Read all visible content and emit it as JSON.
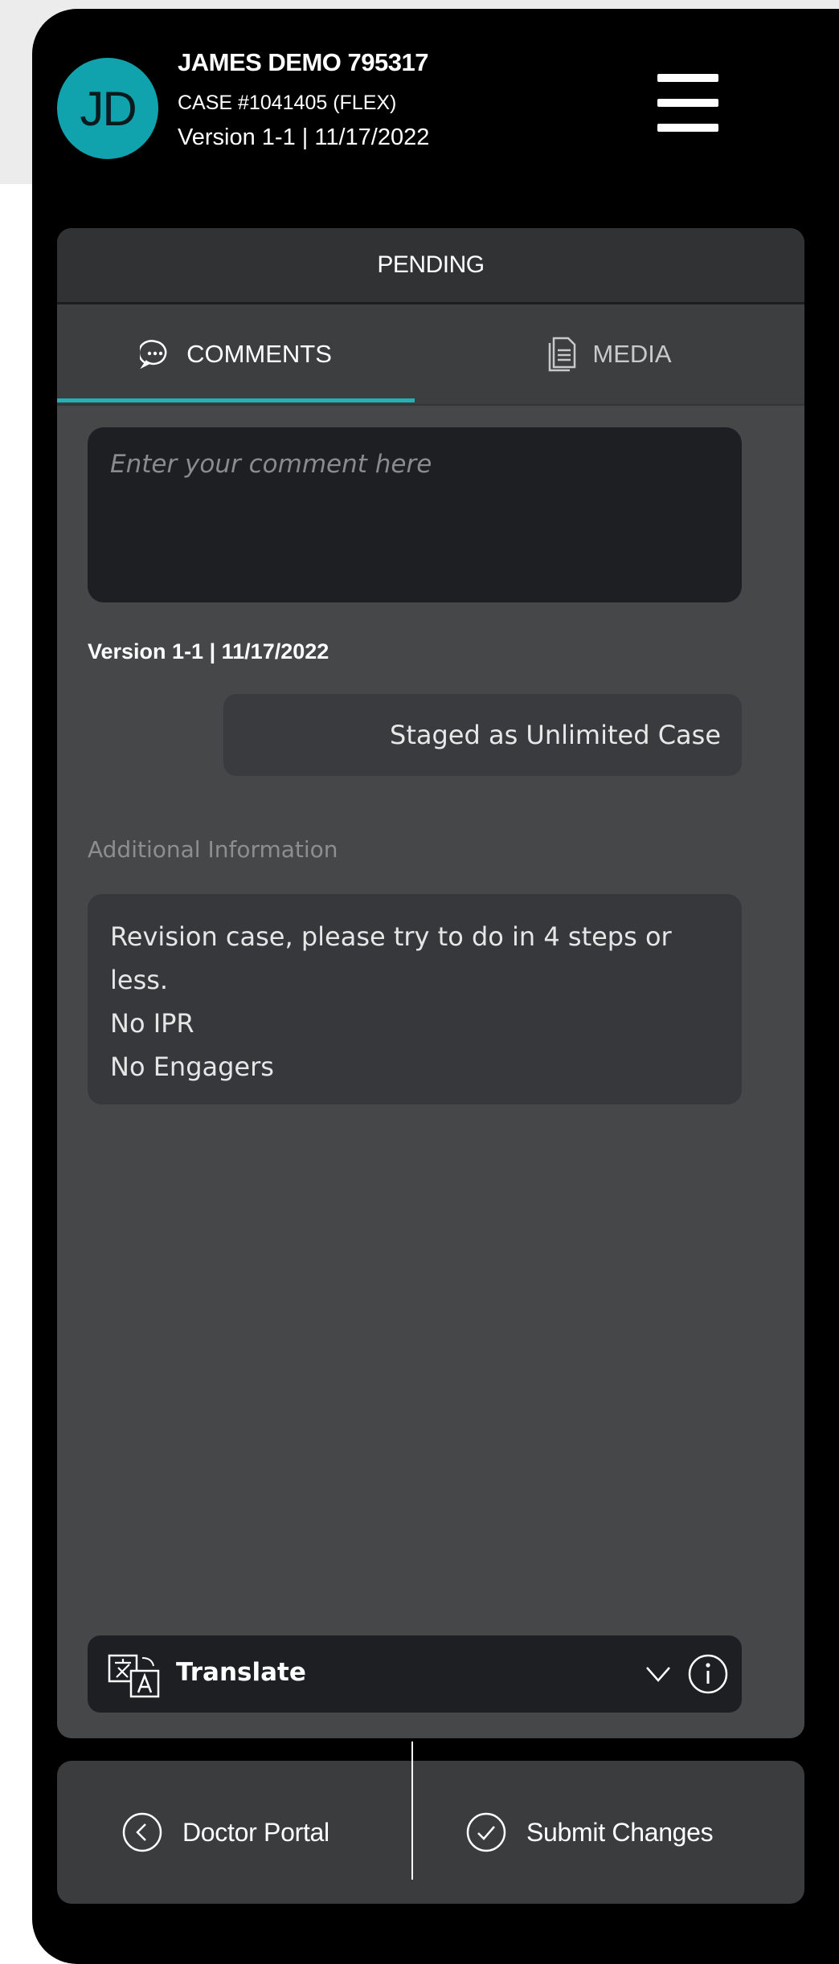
{
  "header": {
    "avatar_initials": "JD",
    "patient_name": "JAMES DEMO 795317",
    "case_line": "CASE #1041405 (FLEX)",
    "version_line": "Version 1-1 | 11/17/2022",
    "menu_icon": "hamburger-menu-icon"
  },
  "status": {
    "label": "PENDING"
  },
  "tabs": [
    {
      "label": "COMMENTS",
      "icon": "comment-bubble-icon",
      "active": true
    },
    {
      "label": "MEDIA",
      "icon": "document-icon",
      "active": false
    }
  ],
  "comment": {
    "placeholder": "Enter your comment here",
    "value": ""
  },
  "history": {
    "version_label": "Version 1-1 | 11/17/2022",
    "staged_message": "Staged as Unlimited Case"
  },
  "additional": {
    "label": "Additional Information",
    "lines": [
      "Revision case, please try to do in 4 steps or",
      "less.",
      "No IPR",
      "No Engagers"
    ]
  },
  "translate": {
    "label": "Translate",
    "icon": "translate-icon",
    "chevron_icon": "chevron-down-icon",
    "info_icon": "info-icon"
  },
  "actions": {
    "doctor_portal": "Doctor Portal",
    "submit_changes": "Submit Changes"
  },
  "colors": {
    "accent": "#23b1b4",
    "avatar": "#11a3ad",
    "panel": "#464749",
    "background": "#000000"
  }
}
